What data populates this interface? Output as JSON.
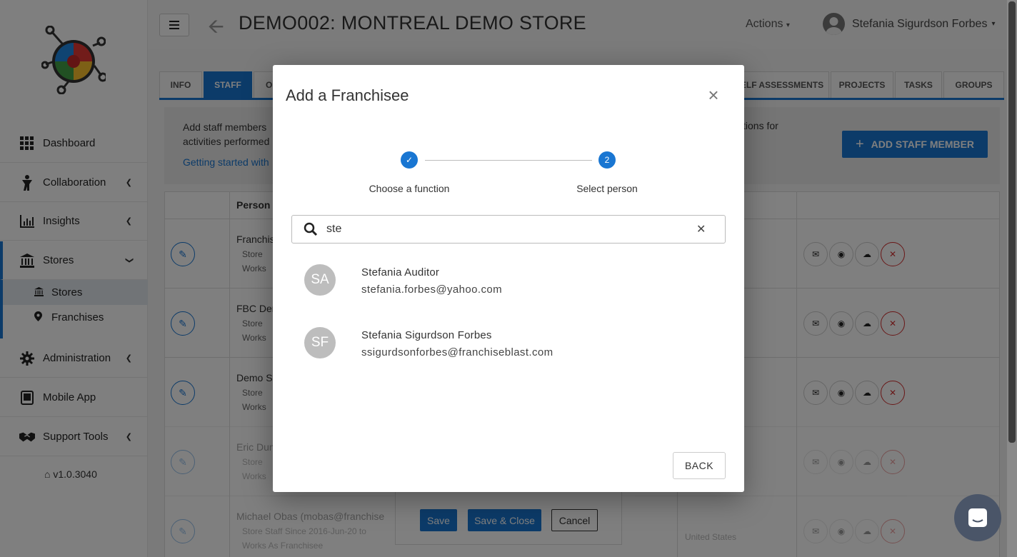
{
  "sidebar": {
    "items": [
      {
        "label": "Dashboard",
        "icon": "grid-icon"
      },
      {
        "label": "Collaboration",
        "icon": "person-icon"
      },
      {
        "label": "Insights",
        "icon": "chart-icon"
      },
      {
        "label": "Stores",
        "icon": "bank-icon"
      },
      {
        "label": "Administration",
        "icon": "gear-icon"
      },
      {
        "label": "Mobile App",
        "icon": "tablet-icon"
      },
      {
        "label": "Support Tools",
        "icon": "handshake-icon"
      }
    ],
    "sub_items": [
      {
        "label": "Stores",
        "icon": "bank-icon"
      },
      {
        "label": "Franchises",
        "icon": "map-marker-icon"
      }
    ],
    "version": "v1.0.3040"
  },
  "header": {
    "title": "DEMO002: MONTREAL DEMO STORE",
    "actions_label": "Actions",
    "user_name": "Stefania Sigurdson Forbes"
  },
  "tabs": [
    {
      "label": "INFO"
    },
    {
      "label": "STAFF"
    },
    {
      "label": "O"
    },
    {
      "label": "ELF ASSESSMENTS"
    },
    {
      "label": "PROJECTS"
    },
    {
      "label": "TASKS"
    },
    {
      "label": "GROUPS"
    }
  ],
  "info_panel": {
    "text_line1": "Add staff members",
    "text_line2": "activities performed",
    "text_right": "tions for",
    "link": "Getting started with",
    "add_button": "ADD STAFF MEMBER"
  },
  "table": {
    "header_person": "Person",
    "rows": [
      {
        "name": "Franchisee",
        "meta1": "Store",
        "meta2": "Works"
      },
      {
        "name": "FBC Demo",
        "meta1": "Store",
        "meta2": "Works"
      },
      {
        "name": "Demo Store",
        "meta1": "Store",
        "meta2": "Works"
      },
      {
        "name": "Eric Dunn",
        "meta1": "Store",
        "meta2": "Works"
      },
      {
        "name": "Michael Obas  (mobas@franchise",
        "meta1": "Store Staff Since  2016-Jun-20  to",
        "meta2": "Works As   Franchisee",
        "extra": "United States"
      }
    ]
  },
  "bottom_bar": {
    "save": "Save",
    "save_close": "Save & Close",
    "cancel": "Cancel"
  },
  "modal": {
    "title": "Add a Franchisee",
    "steps": [
      {
        "label": "Choose a function",
        "marker": "✓"
      },
      {
        "label": "Select person",
        "marker": "2"
      }
    ],
    "search_value": "ste",
    "results": [
      {
        "initials": "SA",
        "name": "Stefania Auditor",
        "email": "stefania.forbes@yahoo.com"
      },
      {
        "initials": "SF",
        "name": "Stefania Sigurdson Forbes",
        "email": "ssigurdsonforbes@franchiseblast.com"
      }
    ],
    "back_button": "BACK"
  },
  "colors": {
    "primary": "#1976d2",
    "danger": "#d32f2f",
    "avatar_grey": "#bdbdbd"
  }
}
